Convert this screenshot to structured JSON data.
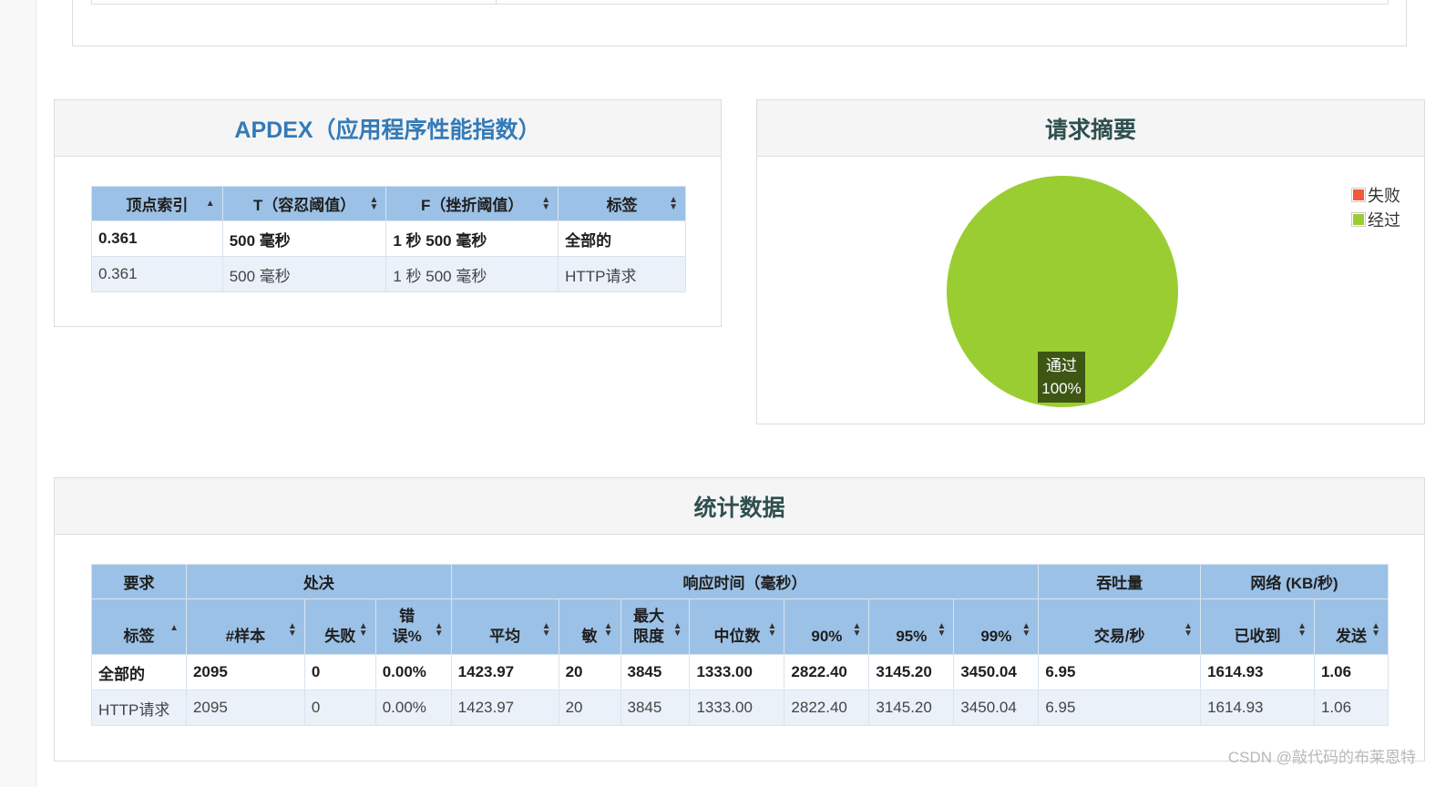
{
  "apdex": {
    "title": "APDEX（应用程序性能指数）",
    "headers": [
      "顶点索引",
      "T（容忍阈值）",
      "F（挫折阈值）",
      "标签"
    ],
    "rows": [
      [
        "0.361",
        "500 毫秒",
        "1 秒 500 毫秒",
        "全部的"
      ],
      [
        "0.361",
        "500 毫秒",
        "1 秒 500 毫秒",
        "HTTP请求"
      ]
    ]
  },
  "summary": {
    "title": "请求摘要",
    "legend": [
      {
        "label": "失败",
        "color": "#f4573a"
      },
      {
        "label": "经过",
        "color": "#9acd32"
      }
    ],
    "slice_label": "通过",
    "slice_percent": "100%"
  },
  "chart_data": {
    "type": "pie",
    "title": "请求摘要",
    "categories": [
      "失败",
      "经过"
    ],
    "values": [
      0,
      100
    ]
  },
  "stats": {
    "title": "统计数据",
    "groups": [
      "要求",
      "处决",
      "响应时间（毫秒）",
      "吞吐量",
      "网络 (KB/秒)"
    ],
    "columns": [
      "标签",
      "#样本",
      "失败",
      "错误%",
      "平均",
      "敏",
      "最大限度",
      "中位数",
      "90%",
      "95%",
      "99%",
      "交易/秒",
      "已收到",
      "发送"
    ],
    "rows": [
      [
        "全部的",
        "2095",
        "0",
        "0.00%",
        "1423.97",
        "20",
        "3845",
        "1333.00",
        "2822.40",
        "3145.20",
        "3450.04",
        "6.95",
        "1614.93",
        "1.06"
      ],
      [
        "HTTP请求",
        "2095",
        "0",
        "0.00%",
        "1423.97",
        "20",
        "3845",
        "1333.00",
        "2822.40",
        "3145.20",
        "3450.04",
        "6.95",
        "1614.93",
        "1.06"
      ]
    ]
  },
  "watermark": "CSDN @敲代码的布莱恩特",
  "colors": {
    "header_blue": "#9cc1e6",
    "title_blue": "#337ab7",
    "pass_green": "#9acd32",
    "fail_red": "#f4573a"
  }
}
